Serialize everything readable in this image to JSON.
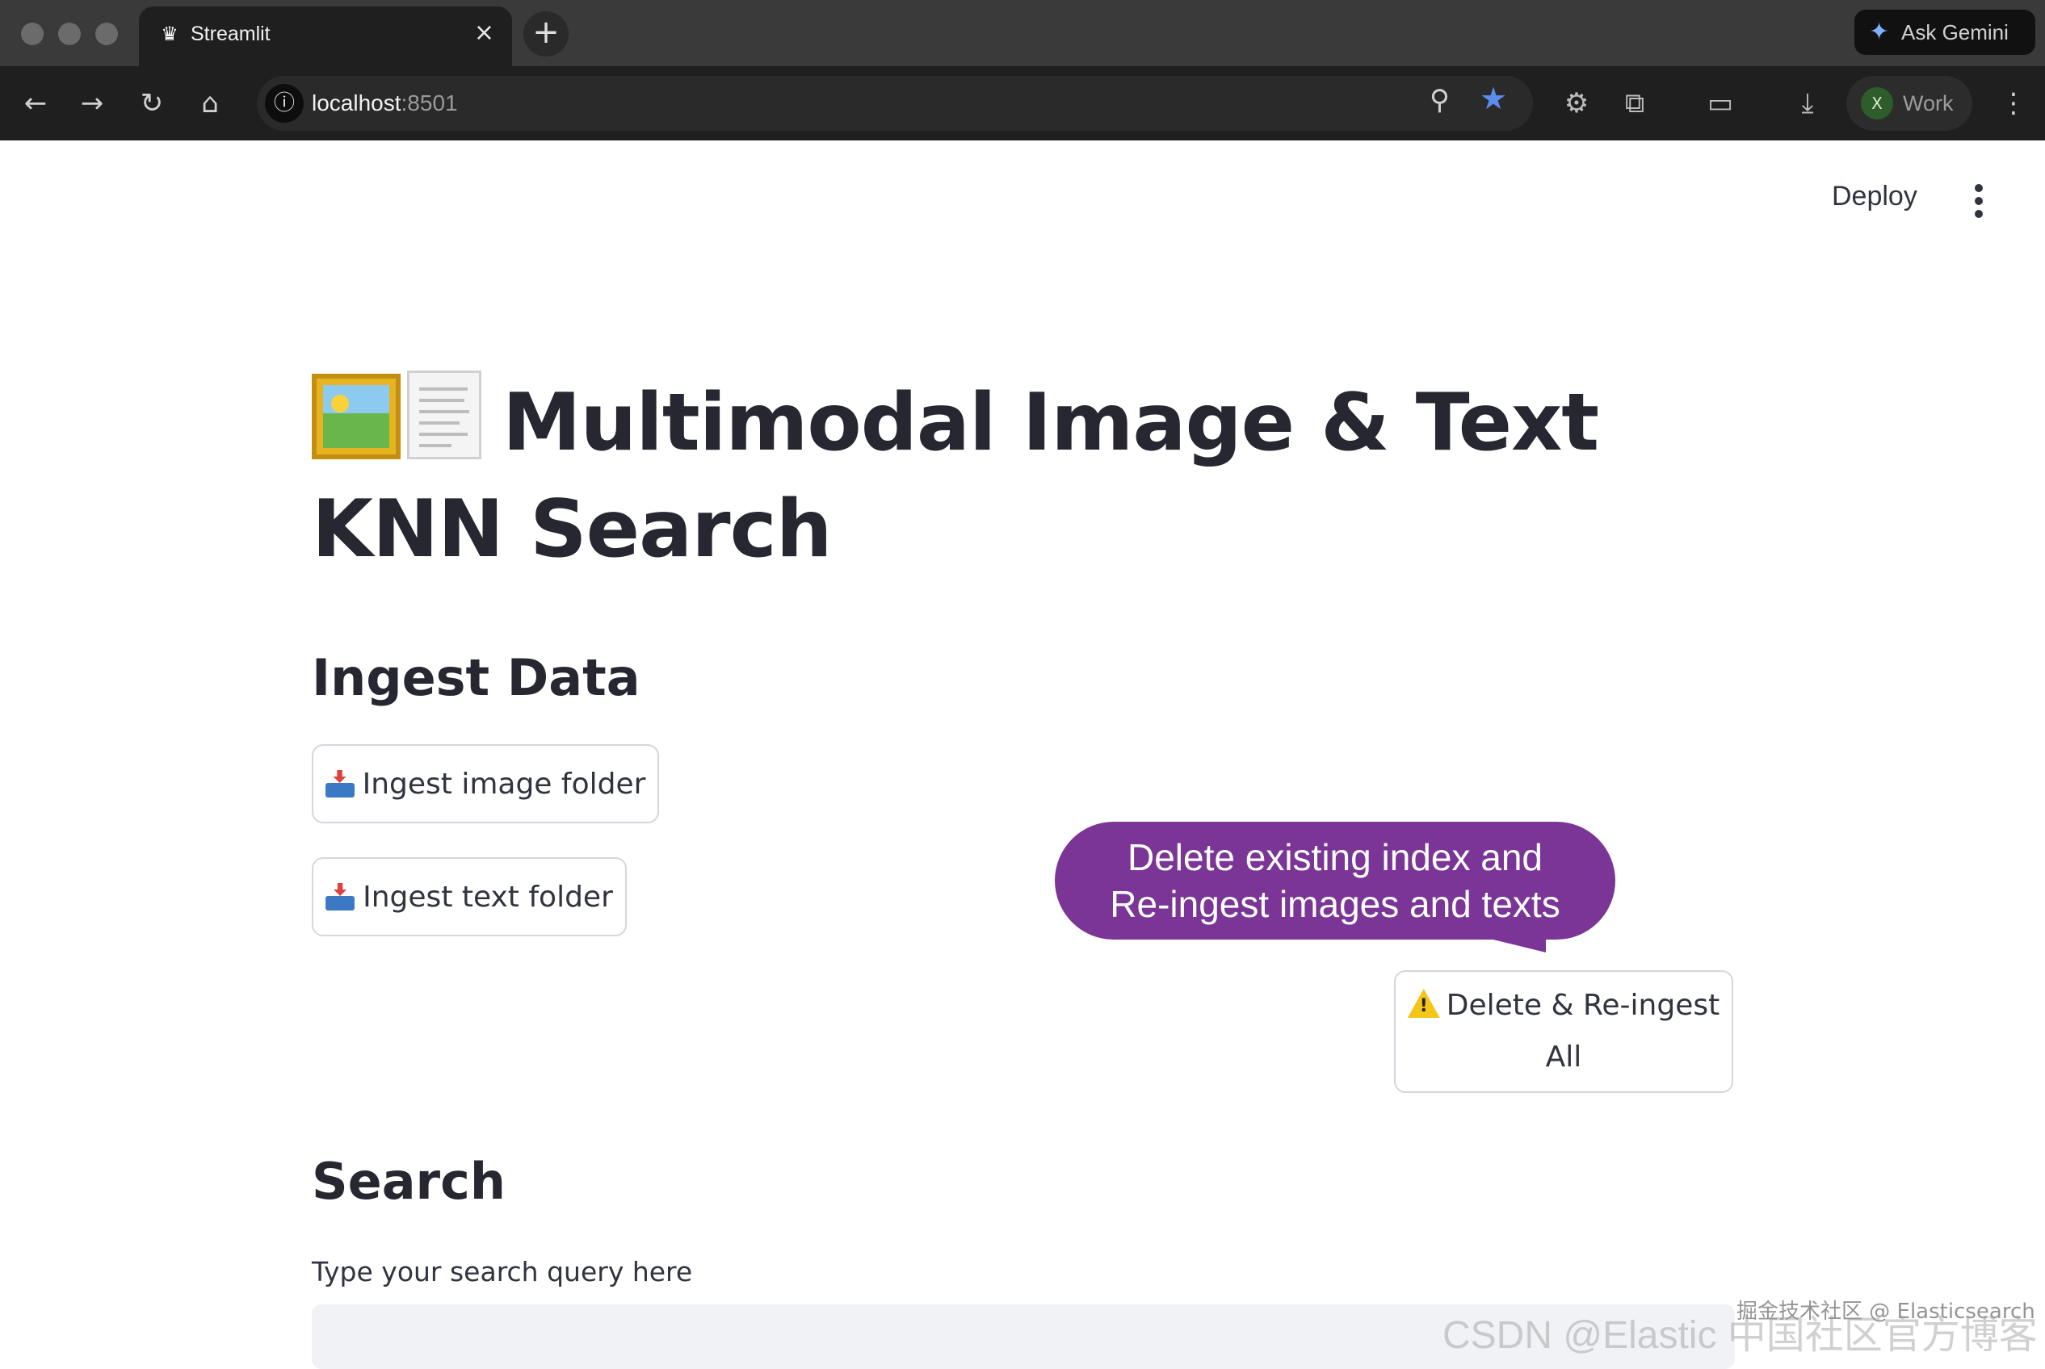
{
  "browser": {
    "tab_title": "Streamlit",
    "tab_close": "×",
    "new_tab": "+",
    "ask_gemini": "Ask Gemini",
    "url_host": "localhost",
    "url_port": ":8501",
    "profile_initial": "X",
    "profile_label": "Work",
    "icons": [
      "back-icon",
      "forward-icon",
      "reload-icon",
      "home-icon",
      "site-info-icon",
      "zoom-icon",
      "bookmark-star-icon",
      "extension-icon",
      "puzzle-icon",
      "tab-search-icon",
      "download-icon",
      "kebab-menu-icon"
    ]
  },
  "app": {
    "deploy_label": "Deploy",
    "title": "Multimodal Image & Text KNN Search",
    "title_emojis": [
      "framed-picture-icon",
      "page-facing-up-icon"
    ],
    "ingest_heading": "Ingest Data",
    "ingest_image_button": "Ingest image folder",
    "ingest_text_button": "Ingest text folder",
    "delete_button_line1": "Delete & Re-ingest",
    "delete_button_line2": "All",
    "callout_line1": "Delete existing index and",
    "callout_line2": "Re-ingest images and texts",
    "search_heading": "Search",
    "query_label": "Type your search query here",
    "query_value": ""
  },
  "watermark": {
    "line1": "掘金技术社区 @ Elasticsearch",
    "line2": "CSDN @Elastic 中国社区官方博客"
  },
  "colors": {
    "accent_callout": "#7a3596",
    "text": "#31333f",
    "input_bg": "#f0f2f6"
  }
}
